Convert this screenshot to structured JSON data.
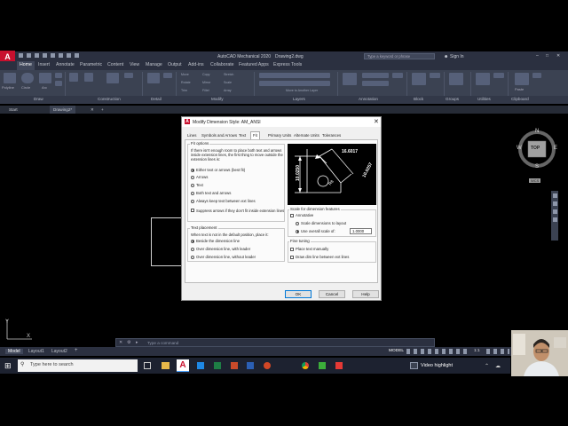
{
  "titlebar": {
    "app_title": "AutoCAD Mechanical 2020",
    "document": "Drawing2.dwg",
    "search_placeholder": "Type a keyword or phrase",
    "signin": "Sign In"
  },
  "ribbon": {
    "tabs": [
      "Home",
      "Insert",
      "Annotate",
      "Parametric",
      "Content",
      "View",
      "Manage",
      "Output",
      "Add-ins",
      "Collaborate",
      "Featured Apps",
      "Express Tools"
    ],
    "active_tab": "Home",
    "panels": [
      "Draw",
      "Construction",
      "Detail",
      "Modify",
      "Layers",
      "Annotation",
      "Block",
      "Groups",
      "Utilities",
      "Clipboard"
    ],
    "draw_tools": [
      "Polyline",
      "Circle",
      "Arc"
    ],
    "modify_tools": [
      "Move",
      "Rotate",
      "Trim",
      "Copy",
      "Mirror",
      "Fillet",
      "Stretch",
      "Scale",
      "Array"
    ],
    "layer_action": "Move to Another Layer",
    "clipboard_tool": "Paste"
  },
  "file_tabs": [
    "Start",
    "Drawing2*"
  ],
  "viewcube": {
    "top_label": "TOP",
    "north": "N",
    "south": "S",
    "east": "E",
    "west": "W",
    "wcs": "WCS"
  },
  "command_line": {
    "placeholder": "Type a command"
  },
  "layout_tabs": [
    "Model",
    "Layout1",
    "Layout2"
  ],
  "status": {
    "model_button": "MODEL",
    "scale": "1:1"
  },
  "taskbar": {
    "search_placeholder": "Type here to search",
    "highlight": "Video highlight",
    "apps": [
      "Task View",
      "File Explorer",
      "AutoCAD",
      "Store",
      "Excel",
      "PowerPoint",
      "Word",
      "PowerPoint 2",
      "Chrome",
      "Camtasia",
      "Camtasia Recorder"
    ]
  },
  "dialog": {
    "title": "Modify Dimension Style: AM_ANSI",
    "tabs": [
      "Lines",
      "Symbols and Arrows",
      "Text",
      "Fit",
      "Primary Units",
      "Alternate Units",
      "Tolerances"
    ],
    "active_tab": "Fit",
    "fit_options": {
      "label": "Fit options",
      "description": "If there isn't enough room to place both text and arrows inside extension lines, the first thing to move outside the extension lines is:",
      "options": [
        "Either text or arrows (best fit)",
        "Arrows",
        "Text",
        "Both text and arrows",
        "Always keep text between ext lines"
      ],
      "selected": 0,
      "suppress_label": "Suppress arrows if they don't fit inside extension lines"
    },
    "text_placement": {
      "label": "Text placement",
      "description": "When text is not in the default position, place it:",
      "options": [
        "Beside the dimension line",
        "Over dimension line, with leader",
        "Over dimension line, without leader"
      ],
      "selected": 0
    },
    "preview": {
      "dim_top": "16.6017",
      "dim_left": "10.0250",
      "dim_right": "10.0257",
      "dim_radius": "R8"
    },
    "scale": {
      "label": "Scale for dimension features",
      "annotative": "Annotative",
      "scale_to_layout": "Scale dimensions to layout",
      "use_overall": "Use overall scale of:",
      "overall_value": "1.0000"
    },
    "fine_tuning": {
      "label": "Fine tuning",
      "place_manually": "Place text manually",
      "draw_dim_line": "Draw dim line between ext lines"
    },
    "buttons": {
      "ok": "OK",
      "cancel": "Cancel",
      "help": "Help"
    }
  },
  "colors": {
    "accent": "#0078d7",
    "ribbon_bg": "#3b4252",
    "canvas_bg": "#000000",
    "autocad_red": "#c8102e"
  }
}
